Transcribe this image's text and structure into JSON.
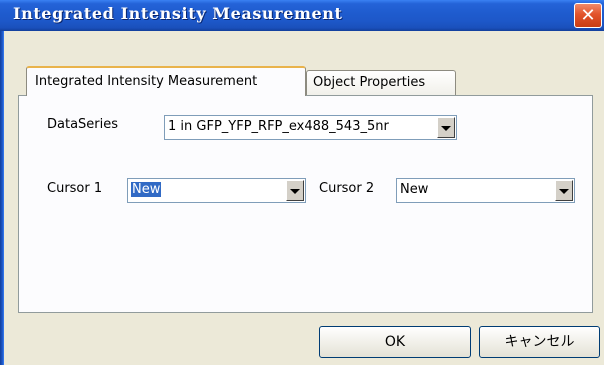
{
  "window": {
    "title": "Integrated Intensity Measurement",
    "close_symbol": "✕"
  },
  "tabs": [
    {
      "label": "Integrated Intensity Measurement",
      "active": true
    },
    {
      "label": "Object Properties",
      "active": false
    }
  ],
  "dataseries": {
    "label": "DataSeries",
    "value": "1 in GFP_YFP_RFP_ex488_543_5nr"
  },
  "cursor1": {
    "label": "Cursor 1",
    "value": "New"
  },
  "cursor2": {
    "label": "Cursor 2",
    "value": "New"
  },
  "buttons": {
    "ok": "OK",
    "cancel": "キャンセル"
  },
  "colors": {
    "titlebar": "#1d57c8",
    "selection": "#316ac5",
    "dialog_face": "#ece9d8",
    "active_tab_accent": "#e9b34b"
  },
  "icons": {
    "close": "close-icon",
    "dropdown": "chevron-down-icon"
  }
}
